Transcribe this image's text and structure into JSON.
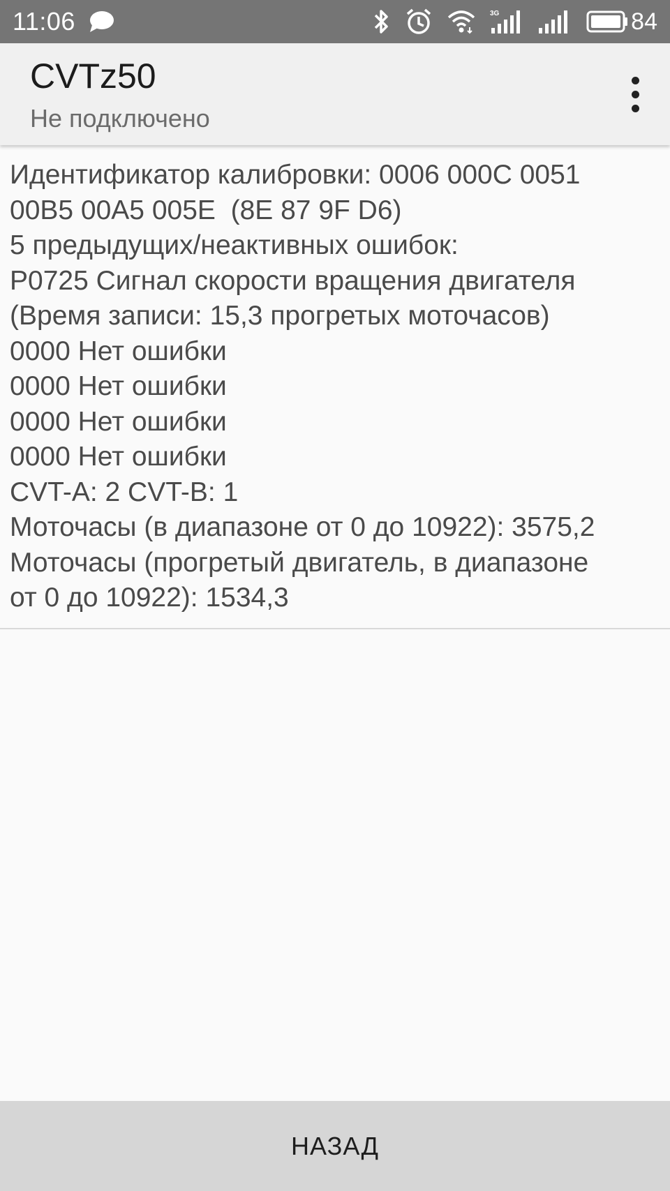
{
  "status_bar": {
    "time": "11:06",
    "battery_percent": "84",
    "icons": [
      "chat-icon",
      "bluetooth-icon",
      "alarm-icon",
      "wifi-icon",
      "signal-3g-icon",
      "signal-icon",
      "battery-icon"
    ]
  },
  "app_bar": {
    "title": "CVTz50",
    "subtitle": "Не подключено",
    "overflow_icon": "more-vert-icon"
  },
  "content": {
    "lines": [
      "Идентификатор калибровки: 0006 000C 0051",
      "00B5 00A5 005E  (8E 87 9F D6)",
      "5 предыдущих/неактивных ошибок:",
      "P0725 Сигнал скорости вращения двигателя",
      "(Время записи: 15,3 прогретых моточасов)",
      "0000 Нет ошибки",
      "0000 Нет ошибки",
      "0000 Нет ошибки",
      "0000 Нет ошибки",
      "CVT-A: 2 CVT-B: 1",
      "Моточасы (в диапазоне от 0 до 10922): 3575,2",
      "Моточасы (прогретый двигатель, в диапазоне",
      "от 0 до 10922): 1534,3"
    ]
  },
  "footer": {
    "back_label": "НАЗАД"
  },
  "colors": {
    "status_bar": "#757575",
    "app_bar": "#f0f0f0",
    "background": "#fafafa",
    "text": "#4a4a4a",
    "button": "#d6d6d6"
  }
}
